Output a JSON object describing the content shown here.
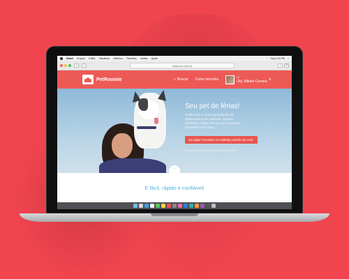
{
  "menubar": {
    "app": "Safari",
    "items": [
      "Arquivo",
      "Editar",
      "Visualizar",
      "Histórico",
      "Favoritos",
      "Janela",
      "Ajuda"
    ],
    "clock": "Seg 4:18 PM"
  },
  "browser": {
    "url": "www.uol.com.br"
  },
  "site": {
    "logo_text": "PetRoomie",
    "nav_search": "Buscar",
    "nav_how": "Como funciona",
    "notif_count": "00",
    "user_name": "Olá, Mikael Carrara"
  },
  "hero": {
    "title": "Seu pet de férias!",
    "description": "PetRoomie é uma comunidade de apaixonados por animais. Nossos anfitriões cuidam do seu pet com amor enquanto você viaja.",
    "cta": "Vai viajar? Encontre um anfitrião pertinho de você.",
    "note": "Hospedagem e pet sitter para cães e gatos."
  },
  "tagline": "É fácil, rápido e confiável!",
  "colors": {
    "background": "#f0454f",
    "header": "#ed5a56",
    "cta": "#e8564f",
    "tagline": "#4fb3d9"
  }
}
